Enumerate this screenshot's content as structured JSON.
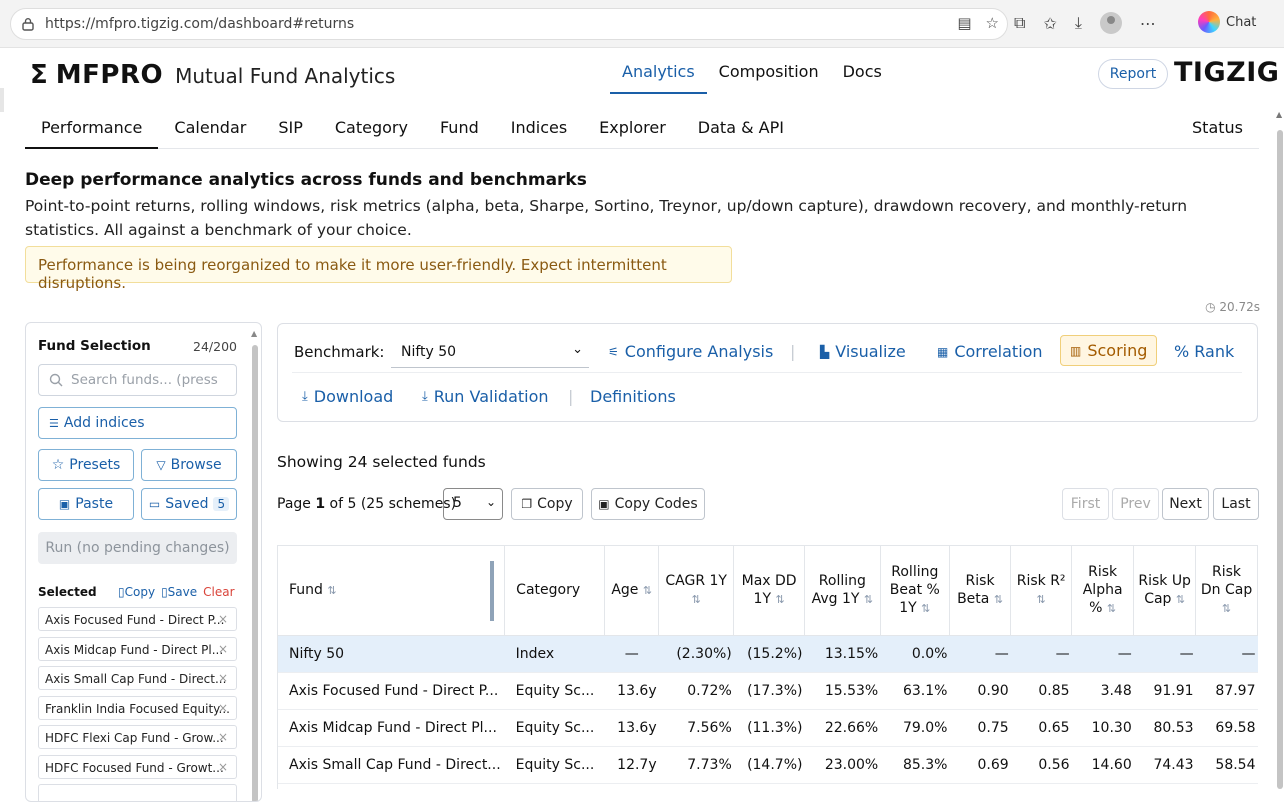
{
  "browser": {
    "url": "https://mfpro.tigzig.com/dashboard#returns",
    "chat_label": "Chat"
  },
  "header": {
    "logo_symbol": "Σ",
    "brand": "MFPRO",
    "subtitle": "Mutual Fund Analytics",
    "nav": [
      "Analytics",
      "Composition",
      "Docs"
    ],
    "report_label": "Report",
    "right_brand": "TIGZIG"
  },
  "subnav": {
    "tabs": [
      "Performance",
      "Calendar",
      "SIP",
      "Category",
      "Fund",
      "Indices",
      "Explorer",
      "Data & API"
    ],
    "status_label": "Status"
  },
  "intro": {
    "title": "Deep performance analytics across funds and benchmarks",
    "description": "Point-to-point returns, rolling windows, risk metrics (alpha, beta, Sharpe, Sortino, Treynor, up/down capture), drawdown recovery, and monthly-return statistics. All against a benchmark of your choice.",
    "notice": "Performance is being reorganized to make it more user-friendly. Expect intermittent disruptions.",
    "timer": "20.72s"
  },
  "fund_panel": {
    "title": "Fund Selection",
    "count": "24/200",
    "search_placeholder": "Search funds... (press",
    "add_indices": "Add indices",
    "presets": "Presets",
    "browse": "Browse",
    "paste": "Paste",
    "saved": "Saved",
    "saved_count": "5",
    "run": "Run (no pending changes)",
    "selected_label": "Selected",
    "copy": "Copy",
    "save": "Save",
    "clear": "Clear",
    "chips": [
      "Axis Focused Fund - Direct P...",
      "Axis Midcap Fund - Direct Pl...",
      "Axis Small Cap Fund - Direct...",
      "Franklin India Focused Equity...",
      "HDFC Flexi Cap Fund - Grow...",
      "HDFC Focused Fund - Growt..."
    ]
  },
  "controls": {
    "benchmark_label": "Benchmark:",
    "benchmark_value": "Nifty 50",
    "configure": "Configure Analysis",
    "visualize": "Visualize",
    "correlation": "Correlation",
    "scoring": "Scoring",
    "rank": "% Rank",
    "download": "Download",
    "run_validation": "Run Validation",
    "definitions": "Definitions"
  },
  "results": {
    "showing": "Showing 24 selected funds",
    "page_prefix": "Page ",
    "page_num": "1",
    "page_suffix": " of 5 (25 schemes)",
    "page_size": "5",
    "copy": "Copy",
    "copy_codes": "Copy Codes",
    "first": "First",
    "prev": "Prev",
    "next": "Next",
    "last": "Last"
  },
  "table": {
    "headers": [
      "Fund",
      "Category",
      "Age",
      "CAGR 1Y",
      "Max DD 1Y",
      "Rolling Avg 1Y",
      "Rolling Beat % 1Y",
      "Risk Beta",
      "Risk R²",
      "Risk Alpha %",
      "Risk Up Cap",
      "Risk Dn Cap"
    ],
    "rows": [
      [
        "Nifty 50",
        "Index",
        "—",
        "(2.30%)",
        "(15.2%)",
        "13.15%",
        "0.0%",
        "—",
        "—",
        "—",
        "—",
        "—"
      ],
      [
        "Axis Focused Fund - Direct P...",
        "Equity Sc...",
        "13.6y",
        "0.72%",
        "(17.3%)",
        "15.53%",
        "63.1%",
        "0.90",
        "0.85",
        "3.48",
        "91.91",
        "87.97"
      ],
      [
        "Axis Midcap Fund - Direct Pl...",
        "Equity Sc...",
        "13.6y",
        "7.56%",
        "(11.3%)",
        "22.66%",
        "79.0%",
        "0.75",
        "0.65",
        "10.30",
        "80.53",
        "69.58"
      ],
      [
        "Axis Small Cap Fund - Direct...",
        "Equity Sc...",
        "12.7y",
        "7.73%",
        "(14.7%)",
        "23.00%",
        "85.3%",
        "0.69",
        "0.56",
        "14.60",
        "74.43",
        "58.54"
      ]
    ]
  }
}
